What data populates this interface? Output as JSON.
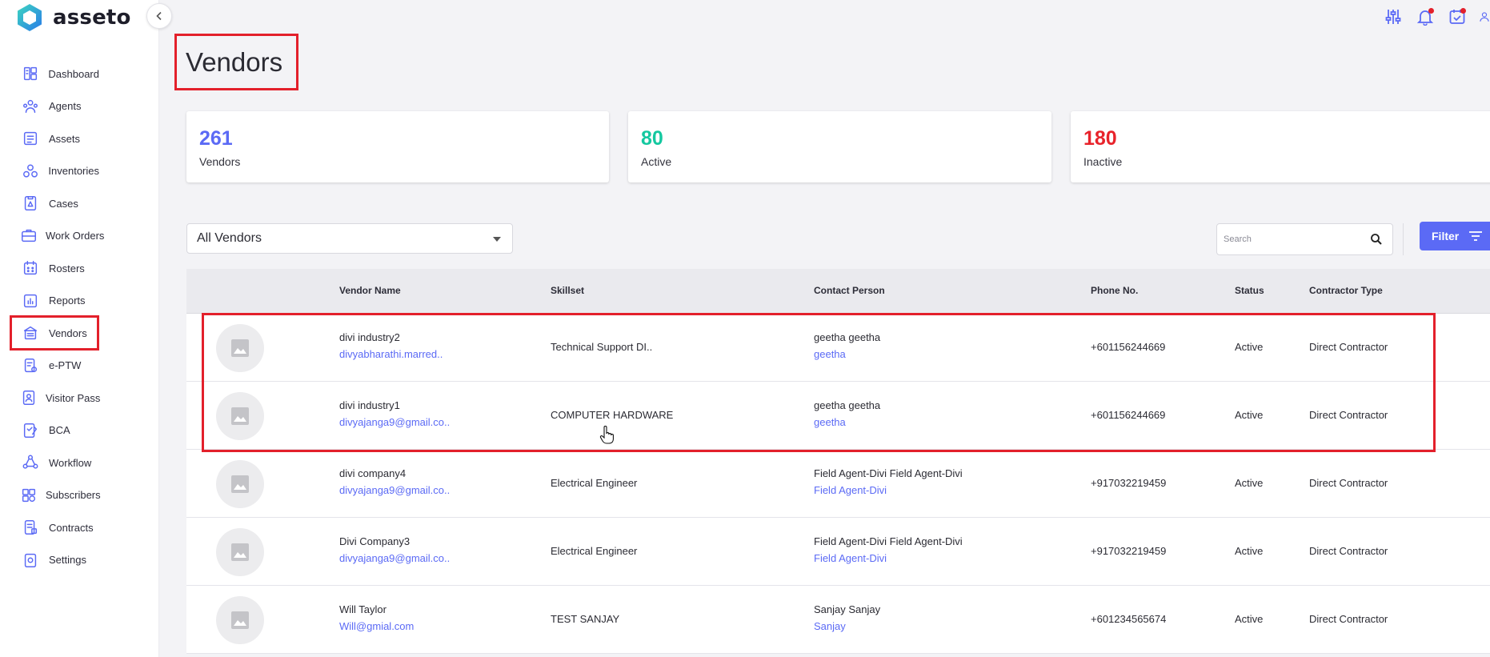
{
  "brand": {
    "name": "asseto"
  },
  "sidebar": {
    "items": [
      {
        "label": "Dashboard",
        "icon": "dashboard-icon"
      },
      {
        "label": "Agents",
        "icon": "agents-icon"
      },
      {
        "label": "Assets",
        "icon": "assets-icon"
      },
      {
        "label": "Inventories",
        "icon": "inventories-icon"
      },
      {
        "label": "Cases",
        "icon": "cases-icon"
      },
      {
        "label": "Work Orders",
        "icon": "work-orders-icon"
      },
      {
        "label": "Rosters",
        "icon": "rosters-icon"
      },
      {
        "label": "Reports",
        "icon": "reports-icon"
      },
      {
        "label": "Vendors",
        "icon": "vendors-icon",
        "active": true
      },
      {
        "label": "e-PTW",
        "icon": "eptw-icon"
      },
      {
        "label": "Visitor Pass",
        "icon": "visitor-pass-icon"
      },
      {
        "label": "BCA",
        "icon": "bca-icon"
      },
      {
        "label": "Workflow",
        "icon": "workflow-icon"
      },
      {
        "label": "Subscribers",
        "icon": "subscribers-icon"
      },
      {
        "label": "Contracts",
        "icon": "contracts-icon"
      },
      {
        "label": "Settings",
        "icon": "settings-icon"
      }
    ]
  },
  "header": {
    "icons": [
      "sliders-icon",
      "bell-icon",
      "calendar-check-icon",
      "user-icon"
    ]
  },
  "page": {
    "title": "Vendors"
  },
  "stats": [
    {
      "value": "261",
      "label": "Vendors",
      "color": "#5b6af5"
    },
    {
      "value": "80",
      "label": "Active",
      "color": "#14c8a0"
    },
    {
      "value": "180",
      "label": "Inactive",
      "color": "#e8232b"
    }
  ],
  "controls": {
    "vendor_filter": "All Vendors",
    "search_placeholder": "Search",
    "filter_label": "Filter"
  },
  "table": {
    "columns": [
      "Vendor Name",
      "Skillset",
      "Contact Person",
      "Phone No.",
      "Status",
      "Contractor Type"
    ],
    "rows": [
      {
        "name": "divi industry2",
        "email": "divyabharathi.marred..",
        "skillset": "Technical Support DI..",
        "contact": "geetha geetha",
        "contact_sub": "geetha",
        "phone": "+601156244669",
        "status": "Active",
        "type": "Direct Contractor"
      },
      {
        "name": "divi industry1",
        "email": "divyajanga9@gmail.co..",
        "skillset": "COMPUTER HARDWARE",
        "contact": "geetha geetha",
        "contact_sub": "geetha",
        "phone": "+601156244669",
        "status": "Active",
        "type": "Direct Contractor"
      },
      {
        "name": "divi company4",
        "email": "divyajanga9@gmail.co..",
        "skillset": "Electrical Engineer",
        "contact": "Field Agent-Divi Field Agent-Divi",
        "contact_sub": "Field Agent-Divi",
        "phone": "+917032219459",
        "status": "Active",
        "type": "Direct Contractor"
      },
      {
        "name": "Divi Company3",
        "email": "divyajanga9@gmail.co..",
        "skillset": "Electrical Engineer",
        "contact": "Field Agent-Divi Field Agent-Divi",
        "contact_sub": "Field Agent-Divi",
        "phone": "+917032219459",
        "status": "Active",
        "type": "Direct Contractor"
      },
      {
        "name": "Will Taylor",
        "email": "Will@gmial.com",
        "skillset": "TEST SANJAY",
        "contact": "Sanjay Sanjay",
        "contact_sub": "Sanjay",
        "phone": "+601234565674",
        "status": "Active",
        "type": "Direct Contractor"
      }
    ]
  }
}
